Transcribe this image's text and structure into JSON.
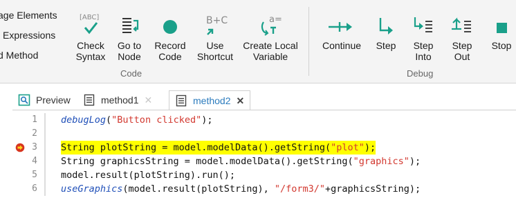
{
  "ribbon": {
    "cutoff_items": [
      "age Elements",
      "l Expressions",
      "d Method"
    ],
    "buttons": [
      {
        "id": "check-syntax",
        "label": "Check\nSyntax",
        "icon": "check-syntax-icon"
      },
      {
        "id": "go-to-node",
        "label": "Go to\nNode",
        "icon": "go-to-node-icon"
      },
      {
        "id": "record-code",
        "label": "Record\nCode",
        "icon": "record-icon"
      },
      {
        "id": "use-shortcut",
        "label": "Use\nShortcut",
        "icon": "shortcut-icon"
      },
      {
        "id": "create-local-variable",
        "label": "Create Local\nVariable",
        "icon": "local-variable-icon"
      },
      {
        "id": "continue",
        "label": "Continue",
        "icon": "continue-icon"
      },
      {
        "id": "step",
        "label": "Step",
        "icon": "step-icon"
      },
      {
        "id": "step-into",
        "label": "Step\nInto",
        "icon": "step-into-icon"
      },
      {
        "id": "step-out",
        "label": "Step\nOut",
        "icon": "step-out-icon"
      },
      {
        "id": "stop",
        "label": "Stop",
        "icon": "stop-icon"
      }
    ],
    "icon_text": {
      "abc": "[ABC]",
      "b_plus_c": "B+C",
      "a_eq": "a="
    },
    "groups": {
      "code": "Code",
      "debug": "Debug"
    },
    "colors": {
      "accent": "#1aa08a",
      "record": "#1aa08a"
    }
  },
  "tabs": [
    {
      "label": "Preview",
      "icon": "preview-icon",
      "closable": false
    },
    {
      "label": "method1",
      "icon": "method-icon",
      "closable": true
    },
    {
      "label": "method2",
      "icon": "method-icon",
      "closable": true,
      "active": true
    }
  ],
  "tab_close_glyph": "✕",
  "editor": {
    "lines": [
      {
        "num": "1",
        "parts": [
          {
            "t": "debugLog",
            "c": "fn-italic"
          },
          {
            "t": "(",
            "c": ""
          },
          {
            "t": "\"Button clicked\"",
            "c": "str"
          },
          {
            "t": ");",
            "c": ""
          }
        ]
      },
      {
        "num": "2",
        "parts": []
      },
      {
        "num": "3",
        "breakpoint": true,
        "highlight": true,
        "parts": [
          {
            "t": "String plotString = model.modelData().getString(",
            "c": ""
          },
          {
            "t": "\"plot\"",
            "c": "str"
          },
          {
            "t": ");",
            "c": ""
          }
        ]
      },
      {
        "num": "4",
        "parts": [
          {
            "t": "String graphicsString = model.modelData().getString(",
            "c": ""
          },
          {
            "t": "\"graphics\"",
            "c": "str"
          },
          {
            "t": ");",
            "c": ""
          }
        ]
      },
      {
        "num": "5",
        "parts": [
          {
            "t": "model.result(plotString).run();",
            "c": ""
          }
        ]
      },
      {
        "num": "6",
        "parts": [
          {
            "t": "useGraphics",
            "c": "fn-italic"
          },
          {
            "t": "(model.result(plotString), ",
            "c": ""
          },
          {
            "t": "\"/form3/\"",
            "c": "str"
          },
          {
            "t": "+graphicsString);",
            "c": ""
          }
        ]
      }
    ]
  }
}
